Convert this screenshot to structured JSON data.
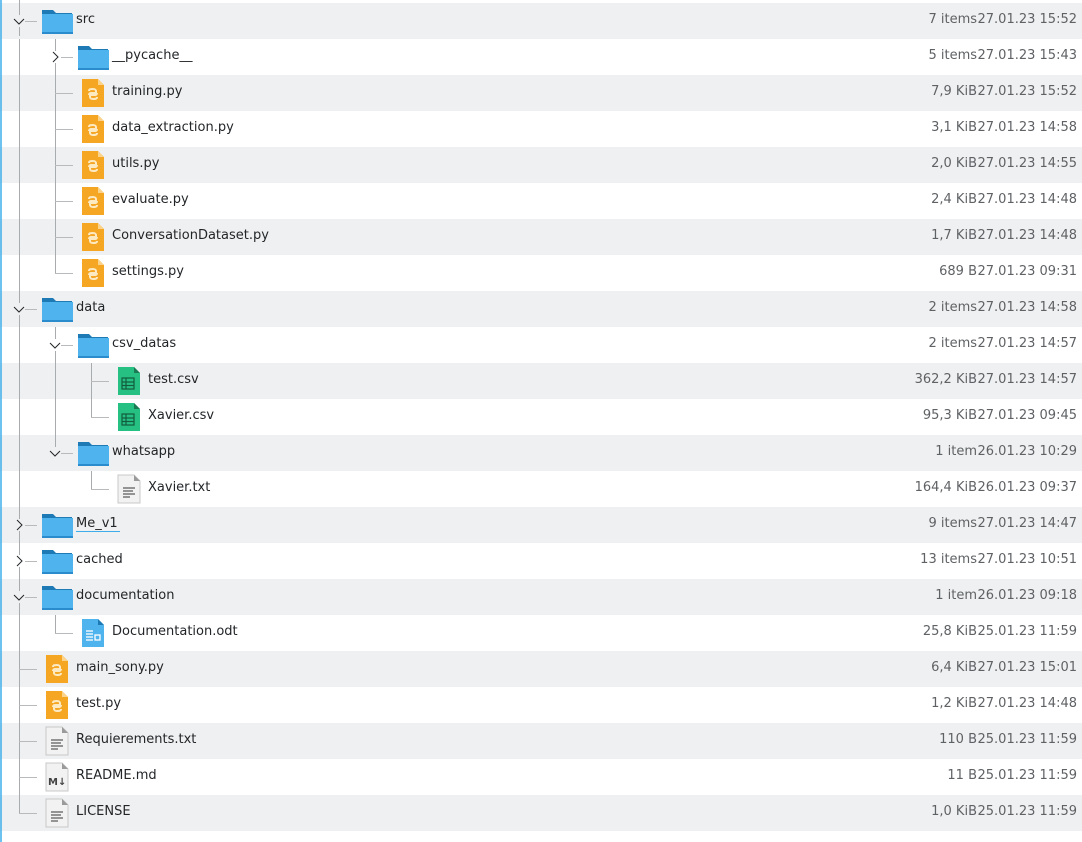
{
  "rows": [
    {
      "name": "src",
      "depth": 0,
      "type": "folder",
      "expanded": true,
      "size": "7 items",
      "date": "27.01.23 15:52"
    },
    {
      "name": "__pycache__",
      "depth": 1,
      "type": "folder",
      "expanded": false,
      "size": "5 items",
      "date": "27.01.23 15:43"
    },
    {
      "name": "training.py",
      "depth": 1,
      "type": "python",
      "size": "7,9 KiB",
      "date": "27.01.23 15:52"
    },
    {
      "name": "data_extraction.py",
      "depth": 1,
      "type": "python",
      "size": "3,1 KiB",
      "date": "27.01.23 14:58"
    },
    {
      "name": "utils.py",
      "depth": 1,
      "type": "python",
      "size": "2,0 KiB",
      "date": "27.01.23 14:55"
    },
    {
      "name": "evaluate.py",
      "depth": 1,
      "type": "python",
      "size": "2,4 KiB",
      "date": "27.01.23 14:48"
    },
    {
      "name": "ConversationDataset.py",
      "depth": 1,
      "type": "python",
      "size": "1,7 KiB",
      "date": "27.01.23 14:48"
    },
    {
      "name": "settings.py",
      "depth": 1,
      "type": "python",
      "size": "689 B",
      "date": "27.01.23 09:31"
    },
    {
      "name": "data",
      "depth": 0,
      "type": "folder",
      "expanded": true,
      "size": "2 items",
      "date": "27.01.23 14:58"
    },
    {
      "name": "csv_datas",
      "depth": 1,
      "type": "folder",
      "expanded": true,
      "size": "2 items",
      "date": "27.01.23 14:57"
    },
    {
      "name": "test.csv",
      "depth": 2,
      "type": "csv",
      "size": "362,2 KiB",
      "date": "27.01.23 14:57"
    },
    {
      "name": "Xavier.csv",
      "depth": 2,
      "type": "csv",
      "size": "95,3 KiB",
      "date": "27.01.23 09:45"
    },
    {
      "name": "whatsapp",
      "depth": 1,
      "type": "folder",
      "expanded": true,
      "size": "1 item",
      "date": "26.01.23 10:29"
    },
    {
      "name": "Xavier.txt",
      "depth": 2,
      "type": "text",
      "size": "164,4 KiB",
      "date": "26.01.23 09:37"
    },
    {
      "name": "Me_v1",
      "depth": 0,
      "type": "folder",
      "expanded": false,
      "hover": true,
      "size": "9 items",
      "date": "27.01.23 14:47"
    },
    {
      "name": "cached",
      "depth": 0,
      "type": "folder",
      "expanded": false,
      "size": "13 items",
      "date": "27.01.23 10:51"
    },
    {
      "name": "documentation",
      "depth": 0,
      "type": "folder",
      "expanded": true,
      "size": "1 item",
      "date": "26.01.23 09:18"
    },
    {
      "name": "Documentation.odt",
      "depth": 1,
      "type": "odt",
      "size": "25,8 KiB",
      "date": "25.01.23 11:59"
    },
    {
      "name": "main_sony.py",
      "depth": 0,
      "type": "python",
      "size": "6,4 KiB",
      "date": "27.01.23 15:01"
    },
    {
      "name": "test.py",
      "depth": 0,
      "type": "python",
      "size": "1,2 KiB",
      "date": "27.01.23 14:48"
    },
    {
      "name": "Requierements.txt",
      "depth": 0,
      "type": "text",
      "size": "110 B",
      "date": "25.01.23 11:59"
    },
    {
      "name": "README.md",
      "depth": 0,
      "type": "markdown",
      "size": "11 B",
      "date": "25.01.23 11:59"
    },
    {
      "name": "LICENSE",
      "depth": 0,
      "type": "text",
      "size": "1,0 KiB",
      "date": "25.01.23 11:59"
    }
  ],
  "colors": {
    "accent": "#3daee9",
    "folder": "#3daee9",
    "python": "#f5a623",
    "csv": "#27ae60",
    "odt": "#3daee9"
  }
}
